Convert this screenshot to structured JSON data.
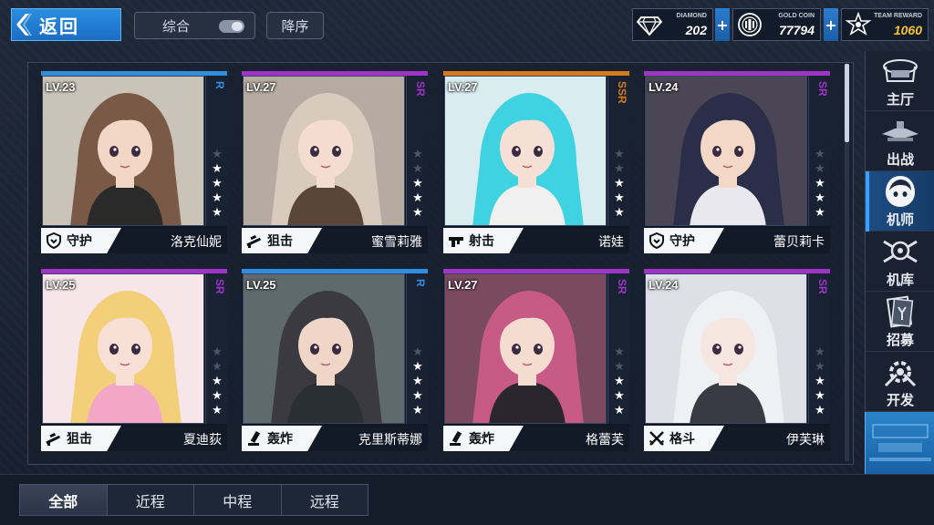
{
  "header": {
    "back_label": "返回",
    "filter_label": "综合",
    "sort_label": "降序",
    "currencies": [
      {
        "label": "DIAMOND",
        "value": "202",
        "icon": "diamond-icon",
        "color": "#ffffff"
      },
      {
        "label": "GOLD COIN",
        "value": "77794",
        "icon": "gold-coin-icon",
        "color": "#ffffff"
      },
      {
        "label": "TEAM REWARD",
        "value": "1060",
        "icon": "team-reward-icon",
        "color": "#f5c531"
      }
    ],
    "plus_label": "+"
  },
  "colors": {
    "R": "#2f8ee0",
    "SR": "#a034c8",
    "SSR": "#d67a1c"
  },
  "pilots": [
    {
      "level": "LV.23",
      "rarity": "R",
      "role": "守护",
      "role_icon": "shield-icon",
      "name": "洛克仙妮",
      "stars": 4,
      "hair": "#7a5a46",
      "skin": "#f2d6c6",
      "outfit": "#2a2a2a",
      "bg": "#c9c3b8"
    },
    {
      "level": "LV.27",
      "rarity": "SR",
      "role": "狙击",
      "role_icon": "sniper-rifle-icon",
      "name": "蜜雪莉雅",
      "stars": 3,
      "hair": "#d8cbbd",
      "skin": "#f4ddd0",
      "outfit": "#5a4638",
      "bg": "#b5aba0"
    },
    {
      "level": "LV.27",
      "rarity": "SSR",
      "role": "射击",
      "role_icon": "gun-icon",
      "name": "诺娃",
      "stars": 3,
      "hair": "#3fd2e0",
      "skin": "#f6e0d6",
      "outfit": "#f0f0f0",
      "bg": "#d9ecf0"
    },
    {
      "level": "LV.24",
      "rarity": "SR",
      "role": "守护",
      "role_icon": "shield-icon",
      "name": "蕾贝莉卡",
      "stars": 3,
      "hair": "#2a2e48",
      "skin": "#f3d8c8",
      "outfit": "#e8e8ee",
      "bg": "#4a4656"
    },
    {
      "level": "LV.25",
      "rarity": "SR",
      "role": "狙击",
      "role_icon": "sniper-rifle-icon",
      "name": "夏迪荻",
      "stars": 3,
      "hair": "#f3cf7a",
      "skin": "#f8e0d6",
      "outfit": "#f4a6c6",
      "bg": "#f6e6ea"
    },
    {
      "level": "LV.25",
      "rarity": "R",
      "role": "轰炸",
      "role_icon": "mortar-icon",
      "name": "克里斯蒂娜",
      "stars": 4,
      "hair": "#3a3a40",
      "skin": "#f0d6c6",
      "outfit": "#2a2f36",
      "bg": "#5f6a6e"
    },
    {
      "level": "LV.27",
      "rarity": "SR",
      "role": "轰炸",
      "role_icon": "mortar-icon",
      "name": "格蕾芙",
      "stars": 3,
      "hair": "#c85a86",
      "skin": "#f4dcd0",
      "outfit": "#2a262e",
      "bg": "#7a4a5e"
    },
    {
      "level": "LV.24",
      "rarity": "SR",
      "role": "格斗",
      "role_icon": "crossed-swords-icon",
      "name": "伊芙琳",
      "stars": 3,
      "hair": "#eef0f4",
      "skin": "#f6e6e0",
      "outfit": "#3a3a44",
      "bg": "#dde0e6"
    }
  ],
  "nav": [
    {
      "label": "主厅",
      "icon": "main-hall-icon"
    },
    {
      "label": "出战",
      "icon": "sortie-icon"
    },
    {
      "label": "机师",
      "icon": "pilot-icon",
      "active": true
    },
    {
      "label": "机库",
      "icon": "hangar-icon"
    },
    {
      "label": "招募",
      "icon": "recruit-icon"
    },
    {
      "label": "开发",
      "icon": "develop-icon"
    }
  ],
  "tabs": [
    {
      "label": "全部",
      "active": true
    },
    {
      "label": "近程"
    },
    {
      "label": "中程"
    },
    {
      "label": "远程"
    }
  ]
}
